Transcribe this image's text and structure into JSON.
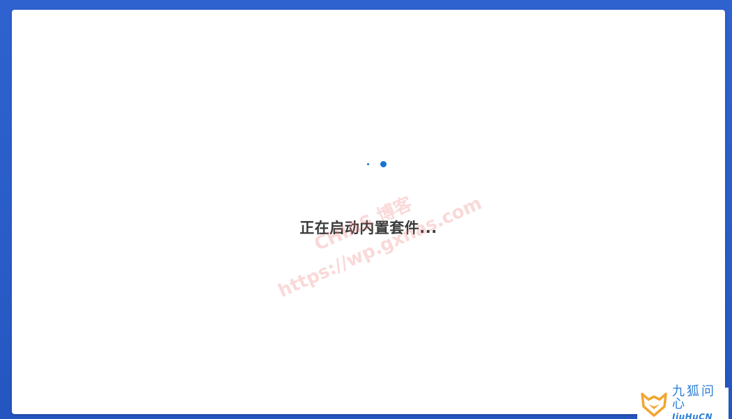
{
  "loading": {
    "status_text": "正在启动内置套件..."
  },
  "watermark": {
    "line1": "CHIAS 博客",
    "line2": "https://wp.gxnas.com"
  },
  "corner_logo": {
    "name_cn": "九狐问心",
    "name_en": "JiuHuCN"
  },
  "colors": {
    "background": "#2a5cc8",
    "panel": "#ffffff",
    "spinner": "#1575d1",
    "text": "#3a3a3a",
    "logo_orange": "#f2a531",
    "logo_blue": "#2b7fd8"
  },
  "icons": {
    "spinner": "loading-spinner-icon",
    "logo": "fox-logo-icon"
  }
}
